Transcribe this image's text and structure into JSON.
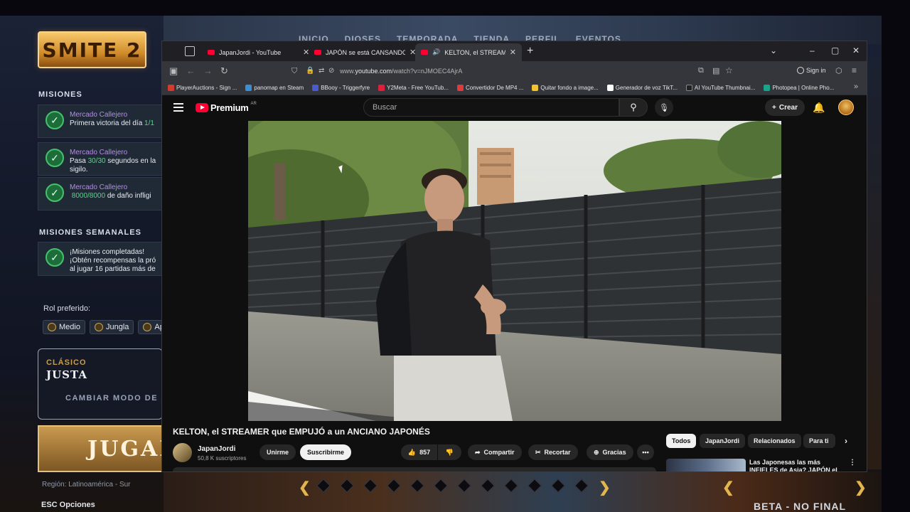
{
  "game": {
    "logo": "SMITE 2",
    "nav": [
      "INICIO",
      "DIOSES",
      "TEMPORADA",
      "TIENDA",
      "PERFIL",
      "EVENTOS"
    ],
    "missions_title": "MISIONES",
    "missions": [
      {
        "title": "Mercado Callejero",
        "pre": "Primera victoria del día ",
        "hl": "1/1",
        "post": ""
      },
      {
        "title": "Mercado Callejero",
        "pre": "Pasa ",
        "hl": "30/30",
        "post": " segundos en la",
        "line2": "sigilo."
      },
      {
        "title": "Mercado Callejero",
        "pre": "",
        "hl": "8000/8000",
        "post": " de daño infligi"
      }
    ],
    "weekly_title": "MISIONES SEMANALES",
    "weekly": {
      "line1": "¡Misiones completadas!",
      "line2": "¡Obtén recompensas la pró",
      "line3": "al jugar 16 partidas más de"
    },
    "rol_label": "Rol preferido:",
    "roles": [
      "Medio",
      "Jungla",
      "Apoyo"
    ],
    "mode": {
      "small": "CLÁSICO",
      "big": "JUSTA",
      "change": "CAMBIAR MODO DE J"
    },
    "play_label": "JUGAR",
    "region": "Región: Latinoamérica - Sur",
    "esc": "ESC  Opciones",
    "beta": "BETA - NO FINAL"
  },
  "browser": {
    "tabs": [
      {
        "title": "JapanJordi - YouTube",
        "active": false
      },
      {
        "title": "JAPÓN se está CANSANDO de",
        "active": false
      },
      {
        "title": "KELTON, el STREAMER que",
        "active": true
      }
    ],
    "url_prefix": "www.",
    "url_host": "youtube.com",
    "url_path": "/watch?v=nJMOEC4AjrA",
    "sign_in": "Sign in",
    "bookmarks": [
      {
        "label": "PlayerAuctions - Sign ...",
        "color": "#d43a2f"
      },
      {
        "label": "panomap en Steam",
        "color": "#3a8ed4"
      },
      {
        "label": "BBooy - Triggerfyre",
        "color": "#4a5bd1"
      },
      {
        "label": "Y2Meta - Free YouTub...",
        "color": "#e0203a"
      },
      {
        "label": "Convertidor De MP4 ...",
        "color": "#e03a3a"
      },
      {
        "label": "Quitar fondo a image...",
        "color": "#f2c230"
      },
      {
        "label": "Generador de voz TikT...",
        "color": "#ffffff"
      },
      {
        "label": "AI YouTube Thumbnai...",
        "color": "#222222"
      },
      {
        "label": "Photopea | Online Pho...",
        "color": "#19a38b"
      }
    ]
  },
  "youtube": {
    "logo_word": "Premium",
    "country": "AR",
    "search_placeholder": "Buscar",
    "create_label": "Crear",
    "video_title": "KELTON, el STREAMER que EMPUJÓ a un ANCIANO JAPONÉS",
    "channel_name": "JapanJordi",
    "channel_subs": "50,8 K suscriptores",
    "join_label": "Unirme",
    "subscribe_label": "Suscribirme",
    "likes": "857",
    "share_label": "Compartir",
    "clip_label": "Recortar",
    "thanks_label": "Gracias",
    "chips": [
      "Todos",
      "JapanJordi",
      "Relacionados",
      "Para ti"
    ],
    "rec_title": "Las Japonesas las más INFIELES de Asia? JAPÓN el"
  }
}
